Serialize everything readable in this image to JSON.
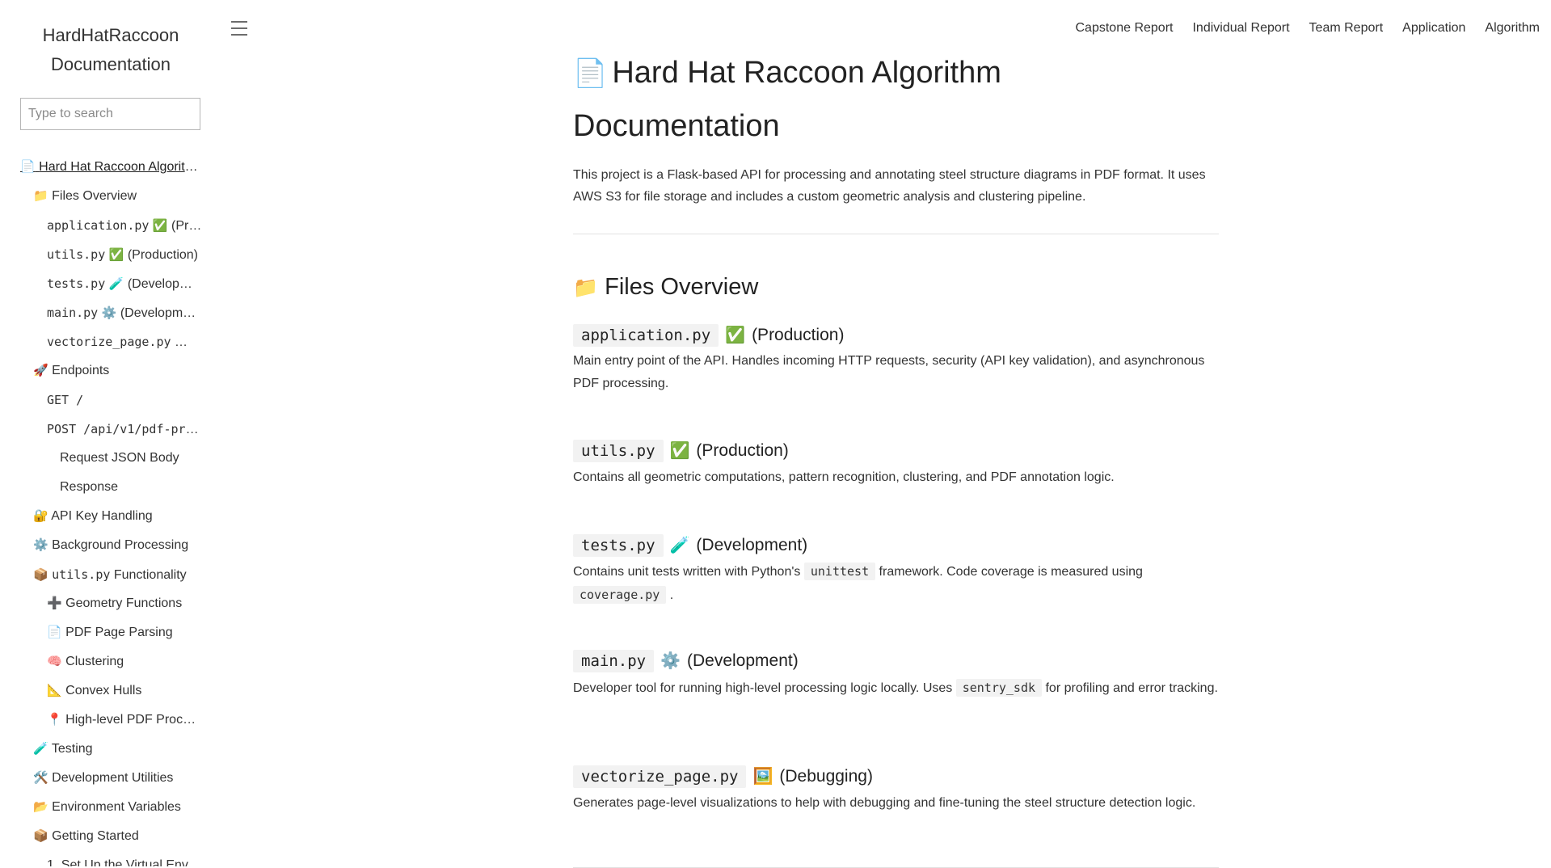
{
  "sidebar": {
    "title_line1": "HardHatRaccoon",
    "title_line2": "Documentation",
    "search_placeholder": "Type to search",
    "toc": [
      {
        "level": 1,
        "icon": "📄",
        "text": "Hard Hat Raccoon Algorithm Documentation"
      },
      {
        "level": 2,
        "icon": "📁",
        "text": "Files Overview"
      },
      {
        "level": 3,
        "code": "application.py",
        "icon": "✅",
        "text": "(Production)"
      },
      {
        "level": 3,
        "code": "utils.py",
        "icon": "✅",
        "text": "(Production)"
      },
      {
        "level": 3,
        "code": "tests.py",
        "icon": "🧪",
        "text": "(Development)"
      },
      {
        "level": 3,
        "code": "main.py",
        "icon": "⚙️",
        "text": "(Development)"
      },
      {
        "level": 3,
        "code": "vectorize_page.py",
        "icon": "🖼️",
        "text": "(Debugging)"
      },
      {
        "level": 2,
        "icon": "🚀",
        "text": "Endpoints"
      },
      {
        "level": 3,
        "code": "GET /"
      },
      {
        "level": 3,
        "code": "POST /api/v1/pdf-processing"
      },
      {
        "level": 4,
        "text": "Request JSON Body"
      },
      {
        "level": 4,
        "text": "Response"
      },
      {
        "level": 2,
        "icon": "🔐",
        "text": "API Key Handling"
      },
      {
        "level": 2,
        "icon": "⚙️",
        "text": "Background Processing"
      },
      {
        "level": 2,
        "icon": "📦",
        "code": "utils.py",
        "text": "Functionality"
      },
      {
        "level": 3,
        "icon": "➕",
        "text": "Geometry Functions"
      },
      {
        "level": 3,
        "icon": "📄",
        "text": "PDF Page Parsing"
      },
      {
        "level": 3,
        "icon": "🧠",
        "text": "Clustering"
      },
      {
        "level": 3,
        "icon": "📐",
        "text": "Convex Hulls"
      },
      {
        "level": 3,
        "icon": "📍",
        "text": "High-level PDF Processing"
      },
      {
        "level": 2,
        "icon": "🧪",
        "text": "Testing"
      },
      {
        "level": 2,
        "icon": "🛠️",
        "text": "Development Utilities"
      },
      {
        "level": 2,
        "icon": "📂",
        "text": "Environment Variables"
      },
      {
        "level": 2,
        "icon": "📦",
        "text": "Getting Started"
      },
      {
        "level": 3,
        "text": "1. Set Up the Virtual Environment"
      }
    ]
  },
  "nav": [
    "Capstone Report",
    "Individual Report",
    "Team Report",
    "Application",
    "Algorithm"
  ],
  "main": {
    "title_icon": "📄",
    "title": "Hard Hat Raccoon Algorithm Documentation",
    "intro": "This project is a Flask-based API for processing and annotating steel structure diagrams in PDF format. It uses AWS S3 for file storage and includes a custom geometric analysis and clustering pipeline.",
    "files_section": {
      "icon": "📁",
      "title": "Files Overview",
      "files": [
        {
          "name": "application.py",
          "icon": "✅",
          "tag": "(Production)",
          "desc": [
            {
              "t": "Main entry point of the API. Handles incoming HTTP requests, security (API key validation), and asynchronous PDF processing."
            }
          ]
        },
        {
          "name": "utils.py",
          "icon": "✅",
          "tag": "(Production)",
          "desc": [
            {
              "t": "Contains all geometric computations, pattern recognition, clustering, and PDF annotation logic."
            }
          ]
        },
        {
          "name": "tests.py",
          "icon": "🧪",
          "tag": "(Development)",
          "desc": [
            {
              "t": "Contains unit tests written with Python's "
            },
            {
              "c": "unittest"
            },
            {
              "t": " framework. Code coverage is measured using "
            },
            {
              "c": "coverage.py"
            },
            {
              "t": " ."
            }
          ]
        },
        {
          "name": "main.py",
          "icon": "⚙️",
          "tag": "(Development)",
          "desc": [
            {
              "t": "Developer tool for running high-level processing logic locally. Uses "
            },
            {
              "c": "sentry_sdk"
            },
            {
              "t": " for profiling and error tracking."
            }
          ]
        },
        {
          "name": "vectorize_page.py",
          "icon": "🖼️",
          "tag": "(Debugging)",
          "desc": [
            {
              "t": "Generates page-level visualizations to help with debugging and fine-tuning the steel structure detection logic."
            }
          ]
        }
      ]
    }
  }
}
